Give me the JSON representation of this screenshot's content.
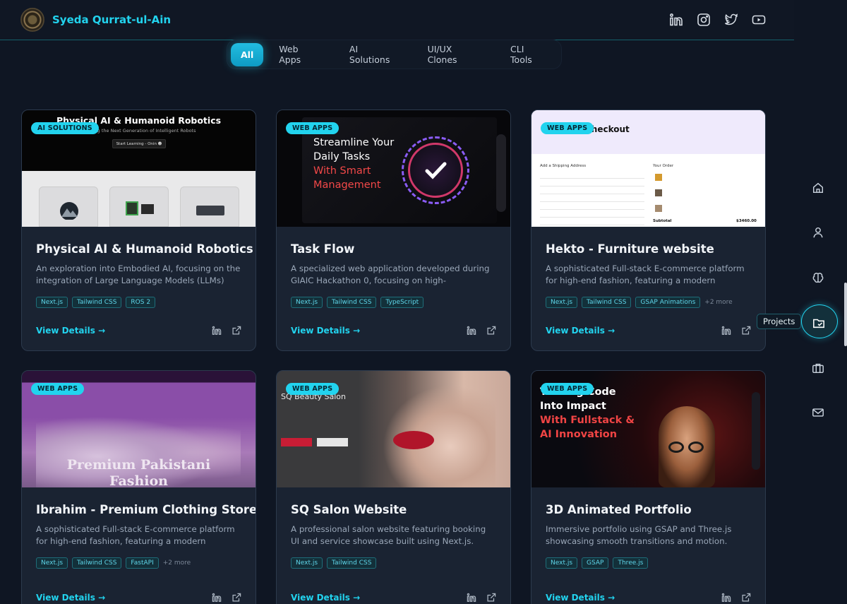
{
  "header": {
    "brand": "Syeda Qurrat-ul-Ain",
    "social_icons": [
      "linkedin-icon",
      "instagram-icon",
      "twitter-icon",
      "youtube-icon"
    ]
  },
  "tabs": [
    {
      "label": "All",
      "active": true
    },
    {
      "label": "Web Apps",
      "active": false
    },
    {
      "label": "AI Solutions",
      "active": false
    },
    {
      "label": "UI/UX Clones",
      "active": false
    },
    {
      "label": "CLI Tools",
      "active": false
    }
  ],
  "projects": [
    {
      "badge": "AI SOLUTIONS",
      "title": "Physical AI & Humanoid Robotics",
      "desc": "An exploration into Embodied AI, focusing on the integration of Large Language Models (LLMs) with...",
      "tags": [
        "Next.js",
        "Tailwind CSS",
        "ROS 2"
      ],
      "more": "",
      "view": "View Details →",
      "thumb": {
        "heading": "Physical AI & Humanoid Robotics",
        "sub": "Building the Next Generation of Intelligent Robots",
        "button": "Start Learning - Onin ☻"
      }
    },
    {
      "badge": "WEB APPS",
      "title": "Task Flow",
      "desc": "A specialized web application developed during GIAIC Hackathon 0, focusing on high-performance UI/UX.",
      "tags": [
        "Next.js",
        "Tailwind CSS",
        "TypeScript"
      ],
      "more": "",
      "view": "View Details →",
      "thumb": {
        "line1": "Streamline Your",
        "line2": "Daily Tasks",
        "line3": "With Smart",
        "line4": "Management"
      }
    },
    {
      "badge": "WEB APPS",
      "title": "Hekto - Furniture website",
      "desc": "A sophisticated Full-stack E-commerce platform for high-end fashion, featuring a modern shopping...",
      "tags": [
        "Next.js",
        "Tailwind CSS",
        "GSAP Animations"
      ],
      "more": "+2 more",
      "view": "View Details →",
      "thumb": {
        "heading": "Checkout",
        "left": "Add a Shipping Address",
        "right": "Your Order",
        "sub": "Subtotal",
        "subval": "$3460.00"
      }
    },
    {
      "badge": "WEB APPS",
      "title": "Ibrahim - Premium Clothing Store",
      "desc": "A sophisticated Full-stack E-commerce platform for high-end fashion, featuring a modern shopping...",
      "tags": [
        "Next.js",
        "Tailwind CSS",
        "FastAPI"
      ],
      "more": "+2 more",
      "view": "View Details →",
      "thumb": {
        "line1": "Premium Pakistani",
        "line2": "Fashion"
      }
    },
    {
      "badge": "WEB APPS",
      "title": "SQ Salon Website",
      "desc": "A professional salon website featuring booking UI and service showcase built using Next.js.",
      "tags": [
        "Next.js",
        "Tailwind CSS"
      ],
      "more": "",
      "view": "View Details →",
      "thumb": {
        "heading": "SQ Beauty Salon"
      }
    },
    {
      "badge": "WEB APPS",
      "title": "3D Animated Portfolio",
      "desc": "Immersive portfolio using GSAP and Three.js showcasing smooth transitions and motion.",
      "tags": [
        "Next.js",
        "GSAP",
        "Three.js"
      ],
      "more": "",
      "view": "View Details →",
      "thumb": {
        "line1": "Turning Code",
        "line2": "Into Impact",
        "line3": "With Fullstack &",
        "line4": "AI Innovation"
      }
    }
  ],
  "side_nav": {
    "icons": [
      "home-icon",
      "user-icon",
      "brain-icon",
      "projects-icon",
      "briefcase-icon",
      "mail-icon"
    ],
    "active_tooltip": "Projects"
  },
  "colors": {
    "accent": "#22d3ee",
    "bg": "#0f1623",
    "card": "#1a2332"
  }
}
